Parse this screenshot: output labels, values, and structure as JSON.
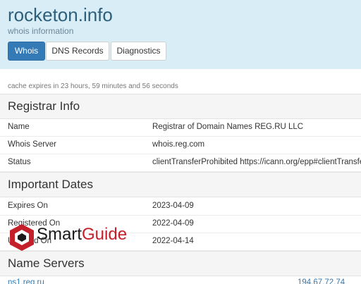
{
  "header": {
    "title": "rocketon.info",
    "subtitle": "whois information",
    "tabs": [
      {
        "label": "Whois",
        "active": true
      },
      {
        "label": "DNS Records",
        "active": false
      },
      {
        "label": "Diagnostics",
        "active": false
      }
    ]
  },
  "cache_note": "cache expires in 23 hours, 59 minutes and 56 seconds",
  "registrar": {
    "heading": "Registrar Info",
    "rows": [
      {
        "key": "Name",
        "value": "Registrar of Domain Names REG.RU LLC"
      },
      {
        "key": "Whois Server",
        "value": "whois.reg.com"
      },
      {
        "key": "Status",
        "value": "clientTransferProhibited https://icann.org/epp#clientTransferProhibited"
      }
    ]
  },
  "dates": {
    "heading": "Important Dates",
    "rows": [
      {
        "key": "Expires On",
        "value": "2023-04-09"
      },
      {
        "key": "Registered On",
        "value": "2022-04-09"
      },
      {
        "key": "Updated On",
        "value": "2022-04-14"
      }
    ]
  },
  "nameservers": {
    "heading": "Name Servers",
    "rows": [
      {
        "host": "ns1.reg.ru",
        "ip": "194.67.72.74"
      }
    ]
  },
  "watermark": {
    "part1": "Smart",
    "part2": "Guide",
    "colors": {
      "logo_red": "#c4202a",
      "logo_dark": "#1a1a1a"
    }
  },
  "colors": {
    "header_bg": "#d9edf7",
    "accent": "#337ab7",
    "section_bg": "#f5f5f5"
  }
}
